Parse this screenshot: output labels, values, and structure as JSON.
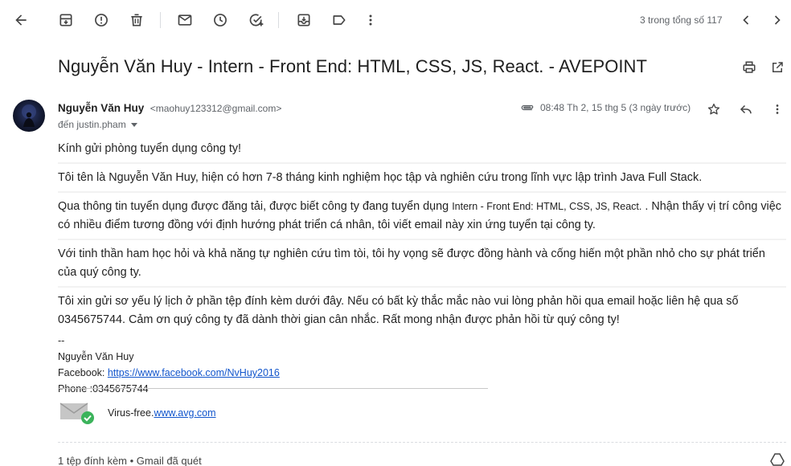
{
  "toolbar": {
    "icons": [
      "back-arrow-icon",
      "archive-icon",
      "report-spam-icon",
      "delete-icon",
      "mark-unread-icon",
      "snooze-icon",
      "add-task-icon",
      "move-to-icon",
      "label-icon",
      "more-icon"
    ],
    "count_text": "3 trong tổng số 117",
    "nav_icons": [
      "chevron-left-icon",
      "chevron-right-icon"
    ]
  },
  "subject": {
    "text": "Nguyễn Văn Huy - Intern - Front End: HTML, CSS, JS, React. - AVEPOINT",
    "icons": [
      "print-icon",
      "open-in-new-window-icon"
    ]
  },
  "message": {
    "sender_name": "Nguyễn Văn Huy",
    "sender_email": "<maohuy123312@gmail.com>",
    "recipient": "đến justin.pham",
    "timestamp": "08:48 Th 2, 15 thg 5 (3 ngày trước)",
    "icons": [
      "attachment-icon",
      "star-icon",
      "reply-icon",
      "more-vert-icon"
    ]
  },
  "body": {
    "p1": "Kính gửi phòng tuyển dụng công ty!",
    "p2": "Tôi tên là Nguyễn Văn Huy, hiện có hơn 7-8 tháng kinh nghiệm học tập và nghiên cứu trong lĩnh vực lập trình Java Full Stack.",
    "p3_before": "Qua thông tin tuyển dụng được đăng tải, được biết công ty đang tuyển dụng ",
    "p3_position": "Intern - Front End: HTML, CSS, JS, React.",
    "p3_after": " . Nhận thấy vị trí công việc có nhiều điểm tương đồng với định hướng phát triển cá nhân, tôi viết email này xin ứng tuyển tại công ty.",
    "p4": "Với tinh thần ham học hỏi và khả năng tự nghiên cứu tìm tòi, tôi hy vọng sẽ được đồng hành và cống hiến một phần nhỏ cho sự phát triển của quý công ty.",
    "p5": "Tôi xin gửi sơ yếu lý lịch ở phần tệp đính kèm dưới đây. Nếu có bất kỳ thắc mắc nào vui lòng phản hồi qua email hoặc liên hệ qua số 0345675744. Cảm ơn quý công ty đã dành thời gian cân nhắc. Rất mong nhận được phản hồi từ quý công ty!"
  },
  "signature": {
    "dashes": "--",
    "name": "Nguyễn Văn Huy",
    "facebook_label": "Facebook: ",
    "facebook_url": "https://www.facebook.com/NvHuy2016",
    "phone": "Phone :0345675744"
  },
  "avg": {
    "label": "Virus-free.",
    "link": "www.avg.com"
  },
  "attachments": {
    "text": "1 tệp đính kèm • Gmail đã quét"
  },
  "colors": {
    "link": "#1155cc",
    "muted": "#5f6368",
    "avg_green": "#3bb35b"
  }
}
